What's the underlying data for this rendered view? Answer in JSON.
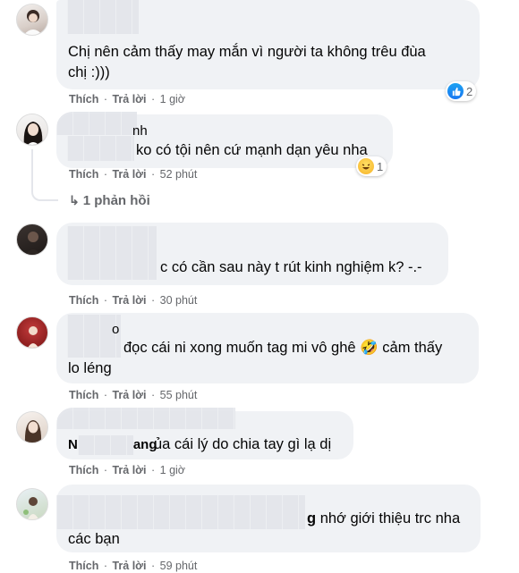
{
  "comments": [
    {
      "name_fragment": "",
      "text_lines": [
        "Chị nên cảm thấy may mắn vì người ta không trêu đùa",
        "chị :)))"
      ],
      "actions": {
        "like": "Thích",
        "reply": "Trả lời",
        "time": "1 giờ"
      },
      "reaction": {
        "icon": "like-icon",
        "count": "2"
      }
    },
    {
      "name_fragment": "nh",
      "text_lines": [
        "ko có tội nên cứ mạnh dạn yêu nha"
      ],
      "actions": {
        "like": "Thích",
        "reply": "Trả lời",
        "time": "52 phút"
      },
      "reaction": {
        "icon": "haha-icon",
        "count": "1"
      },
      "replies_link": "1 phản hồi"
    },
    {
      "name_fragment": "",
      "text_lines": [
        "c có cần sau này t rút kinh nghiệm k? -.-"
      ],
      "actions": {
        "like": "Thích",
        "reply": "Trả lời",
        "time": "30 phút"
      }
    },
    {
      "name_fragment": "o",
      "text_lines": [
        "đọc cái ni xong muốn tag mi vô ghê 🤣 cảm thấy",
        "lo léng"
      ],
      "actions": {
        "like": "Thích",
        "reply": "Trả lời",
        "time": "55 phút"
      }
    },
    {
      "name_fragment": "N",
      "name_fragment_2": "ang",
      "text_lines": [
        "ủa cái lý do chia tay gì lạ dị"
      ],
      "actions": {
        "like": "Thích",
        "reply": "Trả lời",
        "time": "1 giờ"
      }
    },
    {
      "name_fragment": "g",
      "text_lines": [
        "nhớ giới thiệu trc nha",
        "các bạn"
      ],
      "actions": {
        "like": "Thích",
        "reply": "Trả lời",
        "time": "59 phút"
      }
    }
  ],
  "colors": {
    "bubble": "#f0f2f5",
    "meta": "#65676b",
    "like_blue": "#1877f2"
  }
}
